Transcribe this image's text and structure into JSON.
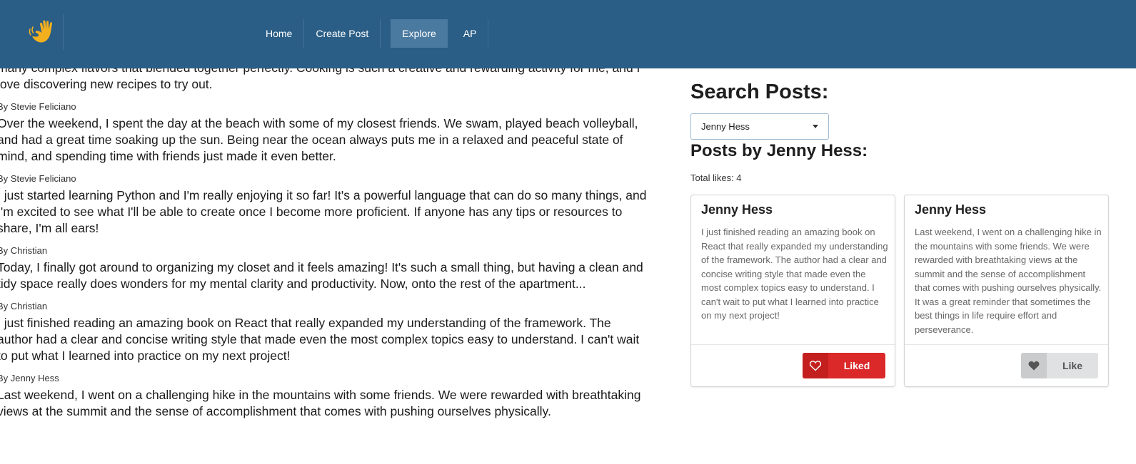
{
  "nav": {
    "items": [
      {
        "label": "Home",
        "active": false
      },
      {
        "label": "Create Post",
        "active": false
      },
      {
        "label": "Explore",
        "active": true
      },
      {
        "label": "AP",
        "active": false
      }
    ],
    "logo_icon": "waving-hand-icon",
    "brand_color": "#2a5e86",
    "logo_color": "#f2b01e"
  },
  "feed": {
    "posts": [
      {
        "author": "",
        "body": "many complex flavors that blended together perfectly. Cooking is such a creative and rewarding activity for me, and I love discovering new recipes to try out."
      },
      {
        "author": "By Stevie Feliciano",
        "body": "Over the weekend, I spent the day at the beach with some of my closest friends. We swam, played beach volleyball, and had a great time soaking up the sun. Being near the ocean always puts me in a relaxed and peaceful state of mind, and spending time with friends just made it even better."
      },
      {
        "author": "By Stevie Feliciano",
        "body": "I just started learning Python and I'm really enjoying it so far! It's a powerful language that can do so many things, and I'm excited to see what I'll be able to create once I become more proficient. If anyone has any tips or resources to share, I'm all ears!"
      },
      {
        "author": "By Christian",
        "body": "Today, I finally got around to organizing my closet and it feels amazing! It's such a small thing, but having a clean and tidy space really does wonders for my mental clarity and productivity. Now, onto the rest of the apartment..."
      },
      {
        "author": "By Christian",
        "body": "I just finished reading an amazing book on React that really expanded my understanding of the framework. The author had a clear and concise writing style that made even the most complex topics easy to understand. I can't wait to put what I learned into practice on my next project!"
      },
      {
        "author": "By Jenny Hess",
        "body": "Last weekend, I went on a challenging hike in the mountains with some friends. We were rewarded with breathtaking views at the summit and the sense of accomplishment that comes with pushing ourselves physically."
      }
    ]
  },
  "search": {
    "heading": "Search Posts:",
    "selected_user": "Jenny Hess",
    "posts_heading": "Posts by Jenny Hess:",
    "total_likes": "Total likes: 4"
  },
  "cards": [
    {
      "title": "Jenny Hess",
      "text": "I just finished reading an amazing book on React that really expanded my understanding of the framework. The author had a clear and concise writing style that made even the most complex topics easy to understand. I can't wait to put what I learned into practice on my next project!",
      "button_label": "Liked",
      "liked": true,
      "button_color": "#db2828"
    },
    {
      "title": "Jenny Hess",
      "text": "Last weekend, I went on a challenging hike in the mountains with some friends. We were rewarded with breathtaking views at the summit and the sense of accomplishment that comes with pushing ourselves physically. It was a great reminder that sometimes the best things in life require effort and perseverance.",
      "button_label": "Like",
      "liked": false,
      "button_color": "#e0e1e2"
    }
  ]
}
